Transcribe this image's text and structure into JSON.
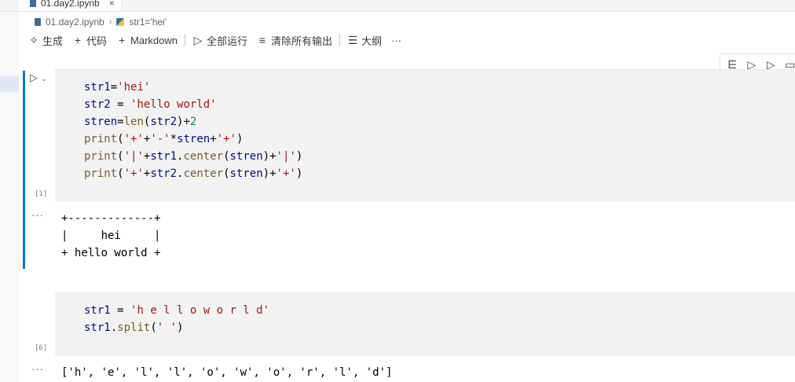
{
  "tab": {
    "label": "01.day2.ipynb",
    "close": "×"
  },
  "breadcrumb": {
    "file": "01.day2.ipynb",
    "symbol": "str1='hei'"
  },
  "toolbar": {
    "generate": "生成",
    "code": "代码",
    "markdown": "Markdown",
    "run_all": "全部运行",
    "clear_outputs": "清除所有输出",
    "outline": "大纲",
    "more": "···"
  },
  "cells": [
    {
      "exec_count": "[1]",
      "source": [
        "str1='hei'",
        "str2 = 'hello world'",
        "stren=len(str2)+2",
        "print('+'+'-'*stren+'+')",
        "print('|'+str1.center(stren)+'|')",
        "print('+'+str2.center(stren)+'+')"
      ],
      "output": [
        "+-------------+",
        "|     hei     |",
        "+ hello world +"
      ]
    },
    {
      "exec_count": "[6]",
      "source": [
        "str1 = 'h e l l o w o r l d'",
        "str1.split(' ')"
      ],
      "output": [
        "['h', 'e', 'l', 'l', 'o', 'w', 'o', 'r', 'l', 'd']"
      ]
    }
  ],
  "output_dots": "···"
}
